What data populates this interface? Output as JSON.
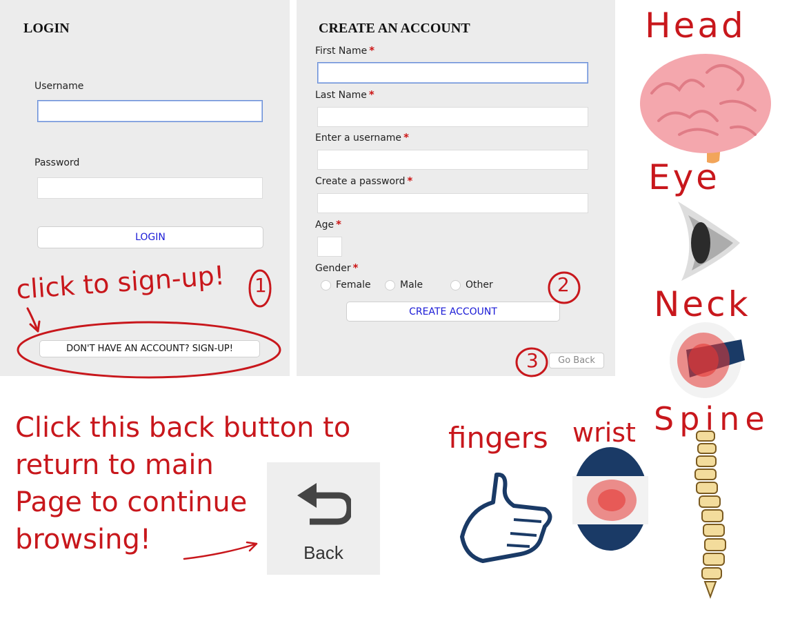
{
  "login": {
    "title": "LOGIN",
    "username_label": "Username",
    "password_label": "Password",
    "login_button": "LOGIN",
    "signup_button": "DON'T HAVE AN ACCOUNT? SIGN-UP!"
  },
  "create_account": {
    "title": "CREATE AN ACCOUNT",
    "first_name_label": "First Name",
    "last_name_label": "Last Name",
    "username_label": "Enter a username",
    "password_label": "Create a password",
    "age_label": "Age",
    "gender_label": "Gender",
    "gender_options": [
      "Female",
      "Male",
      "Other"
    ],
    "create_button": "CREATE ACCOUNT",
    "go_back_button": "Go Back",
    "required_mark": "*"
  },
  "annotations": {
    "signup_note": "click to sign-up!",
    "step1": "1",
    "step2": "2",
    "step3": "3",
    "back_note_line1": "Click this back button to",
    "back_note_line2": "return to main",
    "back_note_line3": "Page to continue",
    "back_note_line4": "browsing!"
  },
  "back_widget": {
    "label": "Back"
  },
  "body_parts": {
    "head": "Head",
    "eye": "Eye",
    "neck": "Neck",
    "spine": "Spine",
    "fingers": "fingers",
    "wrist": "wrist"
  },
  "colors": {
    "annotation": "#c8171c",
    "link_blue": "#1a1ad6",
    "panel_gray": "#ececec"
  }
}
